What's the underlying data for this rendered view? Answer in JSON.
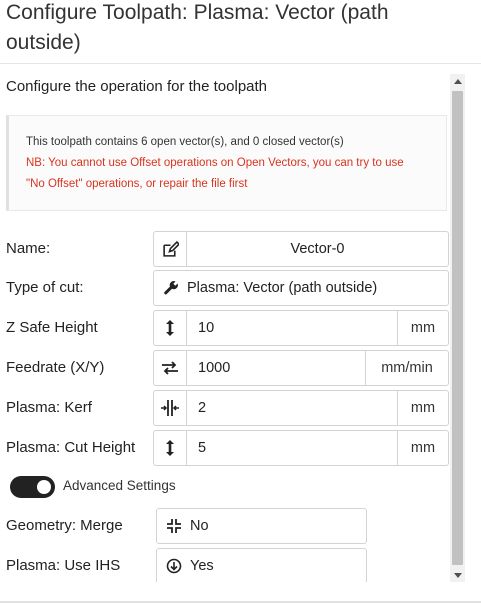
{
  "dialog": {
    "title": "Configure Toolpath: Plasma: Vector (path outside)",
    "subtitle": "Configure the operation for the toolpath"
  },
  "alert": {
    "info": "This toolpath contains 6 open vector(s), and 0 closed vector(s)",
    "warning_line1": "NB: You cannot use Offset operations on Open Vectors, you can try to use",
    "warning_line2": "\"No Offset\" operations, or repair the file first",
    "warning_color": "#d9341f"
  },
  "form": {
    "name": {
      "label": "Name:",
      "icon": "edit-icon",
      "value": "Vector-0"
    },
    "type_of_cut": {
      "label": "Type of cut:",
      "icon": "wrench-icon",
      "value": "Plasma: Vector (path outside)"
    },
    "z_safe_height": {
      "label": "Z Safe Height",
      "icon": "vertical-arrows-icon",
      "value": "10",
      "unit": "mm"
    },
    "feedrate": {
      "label": "Feedrate (X/Y)",
      "icon": "exchange-icon",
      "value": "1000",
      "unit": "mm/min"
    },
    "kerf": {
      "label": "Plasma: Kerf",
      "icon": "kerf-icon",
      "value": "2",
      "unit": "mm"
    },
    "cut_height": {
      "label": "Plasma: Cut Height",
      "icon": "vertical-arrows-icon",
      "value": "5",
      "unit": "mm"
    },
    "advanced": {
      "label": "Advanced Settings",
      "enabled": true
    },
    "geometry_merge": {
      "label": "Geometry: Merge",
      "icon": "compress-icon",
      "value": "No"
    },
    "use_ihs": {
      "label": "Plasma: Use IHS",
      "icon": "arrow-circle-down-icon",
      "value": "Yes"
    }
  }
}
